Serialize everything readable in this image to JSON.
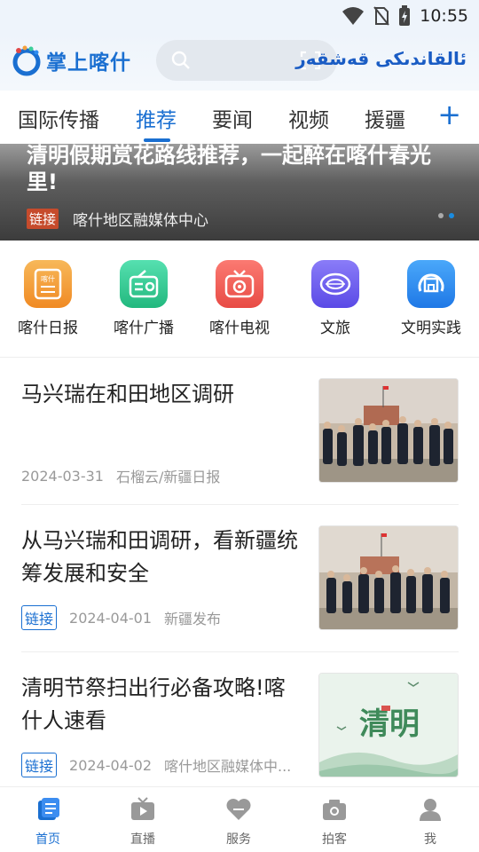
{
  "status_bar": {
    "time": "10:55"
  },
  "header": {
    "app_name": "掌上喀什",
    "uyghur_title": "ئالقاندىكى قەشقەر",
    "search_placeholder": ""
  },
  "tabs": [
    {
      "label": "国际传播"
    },
    {
      "label": "推荐",
      "active": true
    },
    {
      "label": "要闻"
    },
    {
      "label": "视频"
    },
    {
      "label": "援疆"
    }
  ],
  "tab_add_label": "+",
  "banner": {
    "title": "清明假期赏花路线推荐，一起醉在喀什春光里!",
    "tag": "链接",
    "source": "喀什地区融媒体中心"
  },
  "quick_links": [
    {
      "label": "喀什日报",
      "icon": "kashgar-daily-icon",
      "color": "#f4a03c",
      "icon_text": "喀什"
    },
    {
      "label": "喀什广播",
      "icon": "radio-icon",
      "color": "#3ccf9a",
      "icon_text": ""
    },
    {
      "label": "喀什电视",
      "icon": "tv-icon",
      "color": "#f0635c",
      "icon_text": ""
    },
    {
      "label": "文旅",
      "icon": "culture-travel-icon",
      "color": "#6a5cf0",
      "icon_text": ""
    },
    {
      "label": "文明实践",
      "icon": "civilization-practice-icon",
      "color": "#2f8ef0",
      "icon_text": ""
    }
  ],
  "news": [
    {
      "title": "马兴瑞在和田地区调研",
      "tag": "",
      "date": "2024-03-31",
      "source": "石榴云/新疆日报",
      "thumb": "officials-photo"
    },
    {
      "title": "从马兴瑞和田调研，看新疆统筹发展和安全",
      "tag": "链接",
      "date": "2024-04-01",
      "source": "新疆发布",
      "thumb": "officials-photo"
    },
    {
      "title": "清明节祭扫出行必备攻略!喀什人速看",
      "tag": "链接",
      "date": "2024-04-02",
      "source": "喀什地区融媒体中...",
      "thumb": "qingming-illustration",
      "thumb_text": "清明"
    }
  ],
  "bottom_nav": [
    {
      "label": "首页",
      "icon": "home-icon",
      "active": true
    },
    {
      "label": "直播",
      "icon": "live-icon"
    },
    {
      "label": "服务",
      "icon": "service-heart-icon"
    },
    {
      "label": "拍客",
      "icon": "camera-icon"
    },
    {
      "label": "我",
      "icon": "profile-icon"
    }
  ],
  "colors": {
    "accent": "#1a6fd1",
    "tag_red": "#c64b2c"
  }
}
